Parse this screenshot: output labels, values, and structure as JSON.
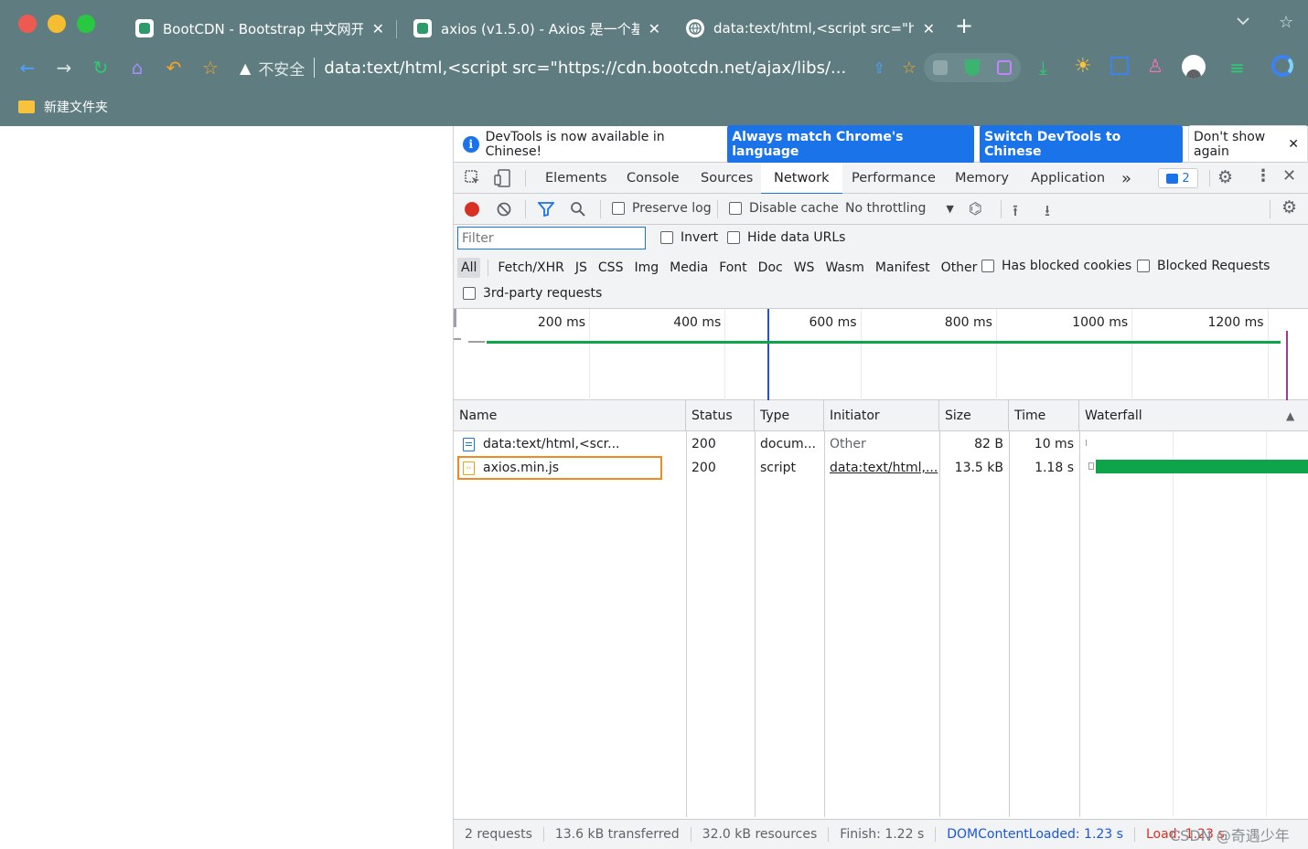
{
  "browser": {
    "tabs": [
      {
        "title": "BootCDN - Bootstrap 中文网开",
        "close": "✕"
      },
      {
        "title": "axios (v1.5.0) - Axios 是一个基",
        "close": "✕"
      },
      {
        "title": "data:text/html,<script src=\"htt",
        "close": "✕"
      }
    ],
    "new_tab": "+",
    "security_label": "不安全",
    "url": "data:text/html,<script src=\"https://cdn.bootcdn.net/ajax/libs/...",
    "bookmark": "新建文件夹"
  },
  "devtools": {
    "infobar": {
      "message": "DevTools is now available in Chinese!",
      "btn_match": "Always match Chrome's language",
      "btn_switch": "Switch DevTools to Chinese",
      "btn_dont": "Don't show again",
      "close": "✕"
    },
    "tabs": [
      "Elements",
      "Console",
      "Sources",
      "Network",
      "Performance",
      "Memory",
      "Application"
    ],
    "more": "»",
    "issues_count": "2",
    "network": {
      "preserve_log": "Preserve log",
      "disable_cache": "Disable cache",
      "throttling": "No throttling",
      "filter_placeholder": "Filter",
      "invert": "Invert",
      "hide_data_urls": "Hide data URLs",
      "types": [
        "All",
        "Fetch/XHR",
        "JS",
        "CSS",
        "Img",
        "Media",
        "Font",
        "Doc",
        "WS",
        "Wasm",
        "Manifest",
        "Other"
      ],
      "has_blocked_cookies": "Has blocked cookies",
      "blocked_requests": "Blocked Requests",
      "third_party": "3rd-party requests",
      "timeline_ticks": [
        "200 ms",
        "400 ms",
        "600 ms",
        "800 ms",
        "1000 ms",
        "1200 ms"
      ],
      "columns": [
        "Name",
        "Status",
        "Type",
        "Initiator",
        "Size",
        "Time",
        "Waterfall"
      ],
      "rows": [
        {
          "name": "data:text/html,<scr...",
          "status": "200",
          "type": "docum...",
          "initiator": "Other",
          "size": "82 B",
          "time": "10 ms"
        },
        {
          "name": "axios.min.js",
          "status": "200",
          "type": "script",
          "initiator": "data:text/html,...",
          "size": "13.5 kB",
          "time": "1.18 s"
        }
      ],
      "status": {
        "requests": "2 requests",
        "transferred": "13.6 kB transferred",
        "resources": "32.0 kB resources",
        "finish": "Finish: 1.22 s",
        "dcl": "DOMContentLoaded: 1.23 s",
        "load": "Load: 1.23 s"
      }
    }
  },
  "watermark": "CSDN @奇遇少年",
  "colors": {
    "chrome": "#5f7d80",
    "accent": "#1a73e8",
    "green": "#0da44a",
    "load": "#d93025",
    "highlight": "#f28b1f"
  }
}
